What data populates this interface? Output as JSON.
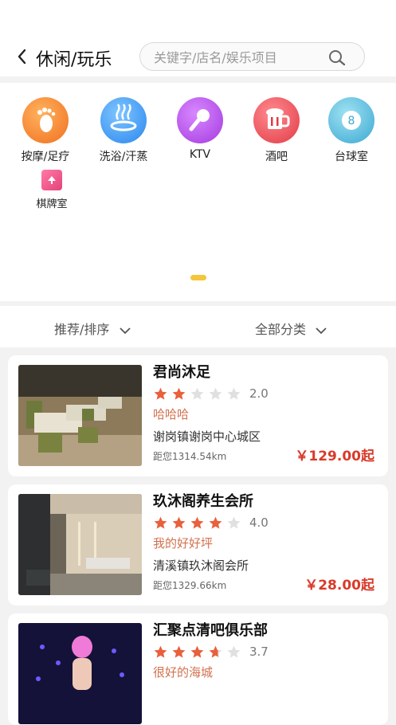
{
  "header": {
    "back_icon": "chevron-left-icon",
    "title": "休闲/玩乐"
  },
  "search": {
    "placeholder": "关键字/店名/娱乐项目",
    "icon": "search-icon"
  },
  "categories": [
    {
      "label": "按摩/足疗",
      "icon": "footprint-icon",
      "color": "#f37a1f"
    },
    {
      "label": "洗浴/汗蒸",
      "icon": "hot-spring-icon",
      "color": "#2f8ff0"
    },
    {
      "label": "KTV",
      "icon": "microphone-icon",
      "color": "#b24de6"
    },
    {
      "label": "酒吧",
      "icon": "beer-mug-icon",
      "color": "#e4434c"
    },
    {
      "label": "台球室",
      "icon": "billiard-ball-icon",
      "color": "#45b3d6"
    },
    {
      "label": "棋牌室",
      "icon": "playing-card-icon",
      "color": "#e4437a"
    }
  ],
  "filters": {
    "sort_label": "推荐/排序",
    "category_label": "全部分类"
  },
  "listings": [
    {
      "name": "君尚沐足",
      "rating": 2.0,
      "rating_text": "2.0",
      "tag": "哈哈哈",
      "address": "谢岗镇谢岗中心城区",
      "distance": "距您1314.54km",
      "price": "￥129.00起"
    },
    {
      "name": "玖沐阁养生会所",
      "rating": 4.0,
      "rating_text": "4.0",
      "tag": "我的好好坪",
      "address": "清溪镇玖沐阁会所",
      "distance": "距您1329.66km",
      "price": "￥28.00起"
    },
    {
      "name": "汇聚点清吧俱乐部",
      "rating": 3.7,
      "rating_text": "3.7",
      "tag": "很好的海城",
      "address": "",
      "distance": "",
      "price": ""
    }
  ],
  "colors": {
    "star_on": "#e8603c",
    "star_off": "#e0e0e0",
    "accent_yellow": "#f5c53b",
    "price": "#d93a2a"
  }
}
